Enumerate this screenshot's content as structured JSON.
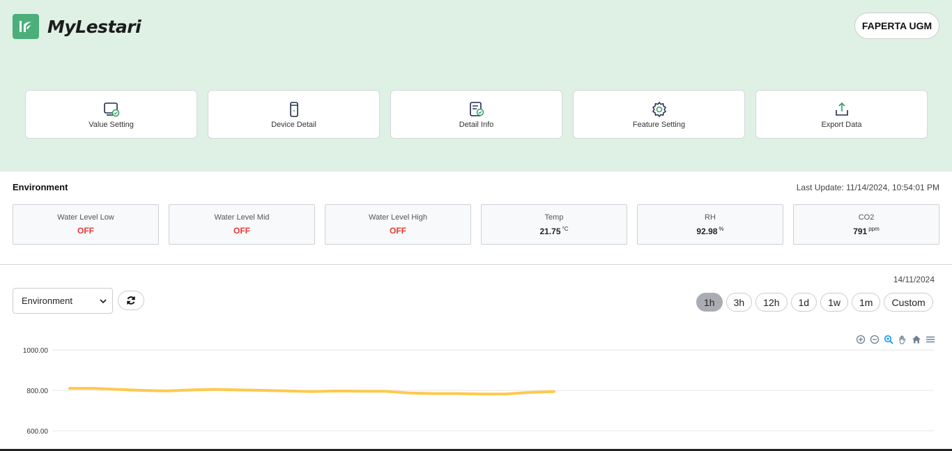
{
  "app": {
    "name": "MyLestari",
    "org": "FAPERTA UGM"
  },
  "menu": [
    {
      "label": "Value Setting",
      "icon": "value-setting-icon"
    },
    {
      "label": "Device Detail",
      "icon": "device-icon"
    },
    {
      "label": "Detail Info",
      "icon": "detail-info-icon"
    },
    {
      "label": "Feature Setting",
      "icon": "gear-icon"
    },
    {
      "label": "Export Data",
      "icon": "export-icon"
    }
  ],
  "environment": {
    "title": "Environment",
    "last_update": "Last Update: 11/14/2024, 10:54:01 PM",
    "sensors": [
      {
        "name": "Water Level Low",
        "value": "OFF",
        "unit": ""
      },
      {
        "name": "Water Level Mid",
        "value": "OFF",
        "unit": ""
      },
      {
        "name": "Water Level High",
        "value": "OFF",
        "unit": ""
      },
      {
        "name": "Temp",
        "value": "21.75",
        "unit": "°C"
      },
      {
        "name": "RH",
        "value": "92.98",
        "unit": "%"
      },
      {
        "name": "CO2",
        "value": "791",
        "unit": "ppm"
      }
    ]
  },
  "chart_controls": {
    "date": "14/11/2024",
    "select_value": "Environment",
    "ranges": [
      "1h",
      "3h",
      "12h",
      "1d",
      "1w",
      "1m",
      "Custom"
    ],
    "active_range": "1h"
  },
  "colors": {
    "header_bg": "#dff0e5",
    "accent": "#4caf7a",
    "off": "#e53935",
    "series": "#ffc94d"
  },
  "chart_data": {
    "type": "line",
    "y_ticks": [
      "1000.00",
      "800.00",
      "600.00"
    ],
    "ylim": [
      600,
      1000
    ],
    "series": [
      {
        "values": [
          810,
          810,
          805,
          800,
          797,
          802,
          805,
          802,
          800,
          797,
          794,
          797,
          796,
          796,
          787,
          784,
          784,
          782,
          782,
          790,
          794
        ]
      }
    ]
  }
}
